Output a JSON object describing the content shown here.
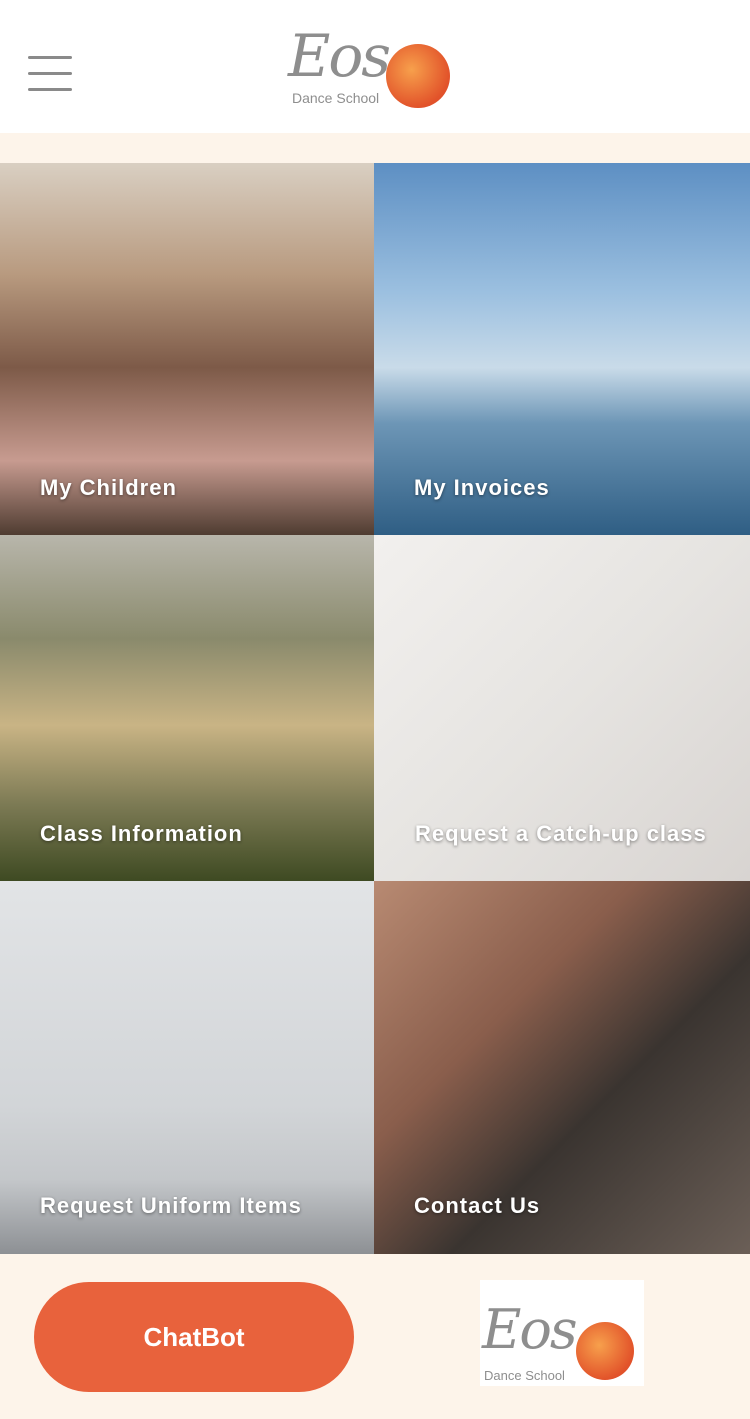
{
  "header": {
    "logo": {
      "name": "Eos",
      "subtitle": "Dance School"
    }
  },
  "tiles": [
    {
      "label": "My Children"
    },
    {
      "label": "My Invoices"
    },
    {
      "label": "Class Information"
    },
    {
      "label": "Request a Catch-up class"
    },
    {
      "label": "Request Uniform Items"
    },
    {
      "label": "Contact Us"
    }
  ],
  "footer": {
    "chatbot_label": "ChatBot",
    "logo": {
      "name": "Eos",
      "subtitle": "Dance School"
    }
  },
  "colors": {
    "accent": "#e8623c",
    "background": "#fdf4ea"
  }
}
